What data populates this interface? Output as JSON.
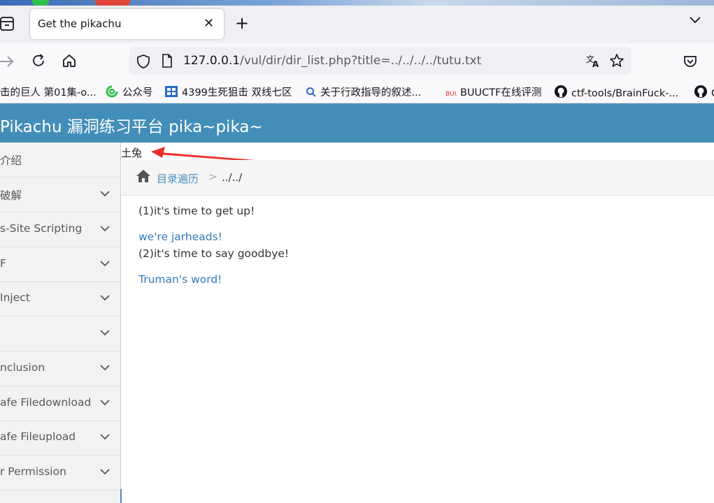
{
  "browser": {
    "tab_title": "Get the pikachu",
    "url_host": "127.0.0.1",
    "url_path": "/vul/dir/dir_list.php?title=../../../../tutu.txt"
  },
  "bookmarks": [
    {
      "label": "击的巨人 第01集-o..."
    },
    {
      "label": "公众号"
    },
    {
      "label": "4399生死狙击 双线七区"
    },
    {
      "label": "关于行政指导的叙述..."
    },
    {
      "label": "BUUCTF在线评测"
    },
    {
      "label": "ctf-tools/BrainFuck-..."
    },
    {
      "label": "G"
    }
  ],
  "header": {
    "title": "Pikachu 漏洞练习平台 pika~pika~"
  },
  "sidebar": {
    "items": [
      {
        "label": "介绍",
        "has_chevron": false
      },
      {
        "label": "破解",
        "has_chevron": true
      },
      {
        "label": "s-Site Scripting",
        "has_chevron": true
      },
      {
        "label": "F",
        "has_chevron": true
      },
      {
        "label": "Inject",
        "has_chevron": true
      },
      {
        "label": "",
        "has_chevron": true
      },
      {
        "label": "nclusion",
        "has_chevron": true
      },
      {
        "label": "afe Filedownload",
        "has_chevron": true
      },
      {
        "label": "afe Fileupload",
        "has_chevron": true
      },
      {
        "label": "r Permission",
        "has_chevron": true
      }
    ]
  },
  "main": {
    "rendered_text": "土兔",
    "breadcrumb": {
      "link": "目录遍历",
      "separator": ">",
      "current": "../../"
    },
    "content": [
      {
        "text": "(1)it's time to get up!",
        "style": "dark"
      },
      {
        "text": "we're jarheads!",
        "style": "link"
      },
      {
        "text": "(2)it's time to say goodbye!",
        "style": "dark"
      },
      {
        "text": "Truman's word!",
        "style": "link"
      }
    ]
  },
  "colors": {
    "header_bg": "#438eb9",
    "link": "#337ab7",
    "annotation_arrow": "#e8312a"
  }
}
